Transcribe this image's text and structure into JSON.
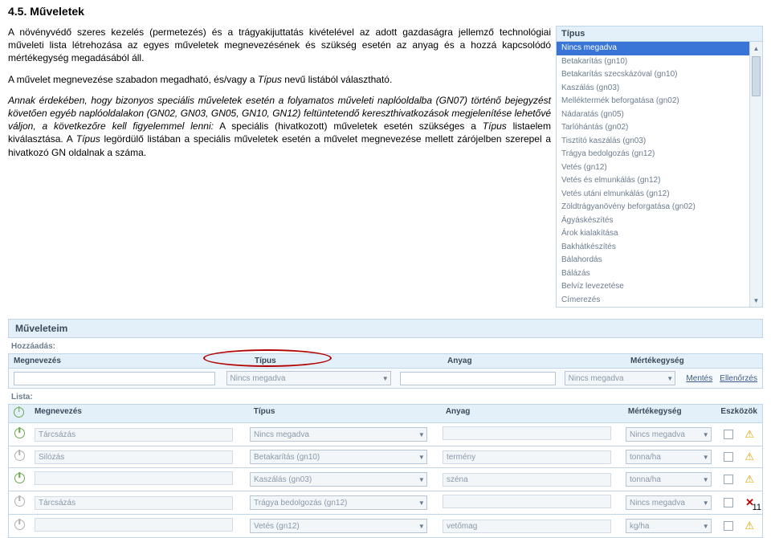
{
  "section_title": "4.5.  Műveletek",
  "para1": "A növényvédő szeres kezelés (permetezés) és a trágyakijuttatás kivételével az adott gazdaságra jellemző technológiai műveleti lista létrehozása az egyes műveletek megnevezésének és szükség esetén az anyag és a hozzá kapcsolódó mértékegység megadásából áll.",
  "para2_a": "A művelet megnevezése szabadon megadható, és/vagy a ",
  "para2_b": "Típus",
  "para2_c": " nevű listából választható.",
  "para3_a": "Annak érdekében, hogy bizonyos speciális műveletek esetén a folyamatos műveleti naplóoldalba (GN07) történő bejegyzést követően egyéb naplóoldalakon (GN02, GN03, GN05, GN10, GN12) feltüntetendő kereszthivatkozások megjelenítése lehetővé váljon, a következőre kell figyelemmel lenni:",
  "para3_b": " A speciális (hivatkozott) műveletek esetén szükséges a ",
  "para3_c": "Típus",
  "para3_d": " listaelem kiválasztása. A ",
  "para3_e": "Típus",
  "para3_f": " legördülő listában a speciális műveletek esetén a művelet megnevezése mellett zárójelben szerepel a hivatkozó GN oldalnak a száma.",
  "tipus": {
    "header": "Típus",
    "items": [
      {
        "label": "Nincs megadva",
        "sel": true
      },
      {
        "label": "Betakarítás (gn10)"
      },
      {
        "label": "Betakarítás szecskázóval (gn10)"
      },
      {
        "label": "Kaszálás (gn03)"
      },
      {
        "label": "Melléktermék beforgatása (gn02)"
      },
      {
        "label": "Nádaratás (gn05)"
      },
      {
        "label": "Tarlóhántás (gn02)"
      },
      {
        "label": "Tisztító kaszálás (gn03)"
      },
      {
        "label": "Trágya bedolgozás (gn12)"
      },
      {
        "label": "Vetés (gn12)"
      },
      {
        "label": "Vetés és elmunkálás (gn12)"
      },
      {
        "label": "Vetés utáni elmunkálás (gn12)"
      },
      {
        "label": "Zöldtrágyanövény beforgatása (gn02)"
      },
      {
        "label": "Ágyáskészítés"
      },
      {
        "label": "Árok kialakítása"
      },
      {
        "label": "Bakhátkészítés"
      },
      {
        "label": "Bálahordás"
      },
      {
        "label": "Bálázás"
      },
      {
        "label": "Belvíz levezetése"
      },
      {
        "label": "Címerezés"
      }
    ]
  },
  "panel": {
    "title": "Műveleteim",
    "add_label": "Hozzáadás:",
    "list_label": "Lista:",
    "cols": {
      "meg": "Megnevezés",
      "tip": "Típus",
      "any": "Anyag",
      "mer": "Mértékegység",
      "esz": "Eszközök"
    },
    "add_row": {
      "tip": "Nincs megadva",
      "mer": "Nincs megadva",
      "btn_save": "Mentés",
      "btn_check": "Ellenőrzés"
    },
    "rows": [
      {
        "on": true,
        "meg": "Tárcsázás",
        "tip": "Nincs megadva",
        "any": "",
        "mer": "Nincs megadva",
        "icon": "warn"
      },
      {
        "on": false,
        "meg": "Silózás",
        "tip": "Betakarítás (gn10)",
        "any": "termény",
        "mer": "tonna/ha",
        "icon": "warn"
      },
      {
        "on": true,
        "meg": "",
        "tip": "Kaszálás (gn03)",
        "any": "széna",
        "mer": "tonna/ha",
        "icon": "warn"
      },
      {
        "on": false,
        "meg": "Tárcsázás",
        "tip": "Trágya bedolgozás (gn12)",
        "any": "",
        "mer": "Nincs megadva",
        "icon": "del"
      },
      {
        "on": false,
        "meg": "",
        "tip": "Vetés (gn12)",
        "any": "vetőmag",
        "mer": "kg/ha",
        "icon": "warn"
      }
    ]
  },
  "page_number": "11"
}
